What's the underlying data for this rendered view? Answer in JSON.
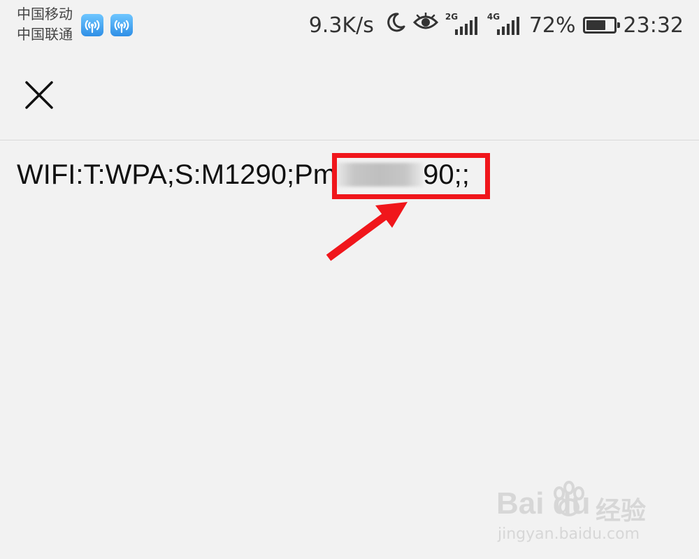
{
  "status_bar": {
    "carrier_1": "中国移动",
    "carrier_2": "中国联通",
    "net_speed": "9.3K/s",
    "sim1_network": "2G",
    "sim2_network": "4G",
    "battery_percent": "72%",
    "battery_level": 0.72,
    "time": "23:32",
    "icons": [
      "wifi-hotspot-icon",
      "wifi-hotspot-icon",
      "moon-icon",
      "eye-icon",
      "signal-icon",
      "signal-icon",
      "battery-icon"
    ]
  },
  "toolbar": {
    "close_icon": "close-icon"
  },
  "content": {
    "text_before": "WIFI:T:WPA;S:M1290;P",
    "text_visible_start": "m",
    "text_visible_end": "90",
    "text_after": ";;"
  },
  "annotation": {
    "box_color": "#f0161b",
    "arrow_color": "#f0161b"
  },
  "watermark": {
    "logo": "Bai du",
    "cn": "经验",
    "url": "jingyan.baidu.com"
  }
}
